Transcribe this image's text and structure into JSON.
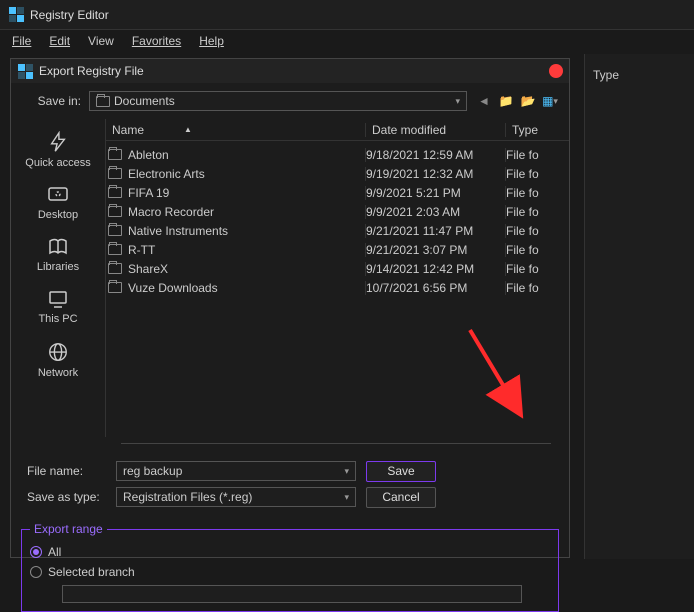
{
  "app": {
    "title": "Registry Editor"
  },
  "menubar": [
    "File",
    "Edit",
    "View",
    "Favorites",
    "Help"
  ],
  "right_panel": {
    "header": "Type"
  },
  "dialog": {
    "title": "Export Registry File",
    "save_in_label": "Save in:",
    "save_in_value": "Documents",
    "columns": {
      "name": "Name",
      "date": "Date modified",
      "type": "Type"
    },
    "rows": [
      {
        "name": "Ableton",
        "date": "9/18/2021 12:59 AM",
        "type": "File fo"
      },
      {
        "name": "Electronic Arts",
        "date": "9/19/2021 12:32 AM",
        "type": "File fo"
      },
      {
        "name": "FIFA 19",
        "date": "9/9/2021 5:21 PM",
        "type": "File fo"
      },
      {
        "name": "Macro Recorder",
        "date": "9/9/2021 2:03 AM",
        "type": "File fo"
      },
      {
        "name": "Native Instruments",
        "date": "9/21/2021 11:47 PM",
        "type": "File fo"
      },
      {
        "name": "R-TT",
        "date": "9/21/2021 3:07 PM",
        "type": "File fo"
      },
      {
        "name": "ShareX",
        "date": "9/14/2021 12:42 PM",
        "type": "File fo"
      },
      {
        "name": "Vuze Downloads",
        "date": "10/7/2021 6:56 PM",
        "type": "File fo"
      }
    ],
    "sidebar": [
      "Quick access",
      "Desktop",
      "Libraries",
      "This PC",
      "Network"
    ],
    "file_name_label": "File name:",
    "file_name_value": "reg backup",
    "save_type_label": "Save as type:",
    "save_type_value": "Registration Files (*.reg)",
    "save_btn": "Save",
    "cancel_btn": "Cancel",
    "export_legend": "Export range",
    "radio_all": "All",
    "radio_branch": "Selected branch"
  }
}
